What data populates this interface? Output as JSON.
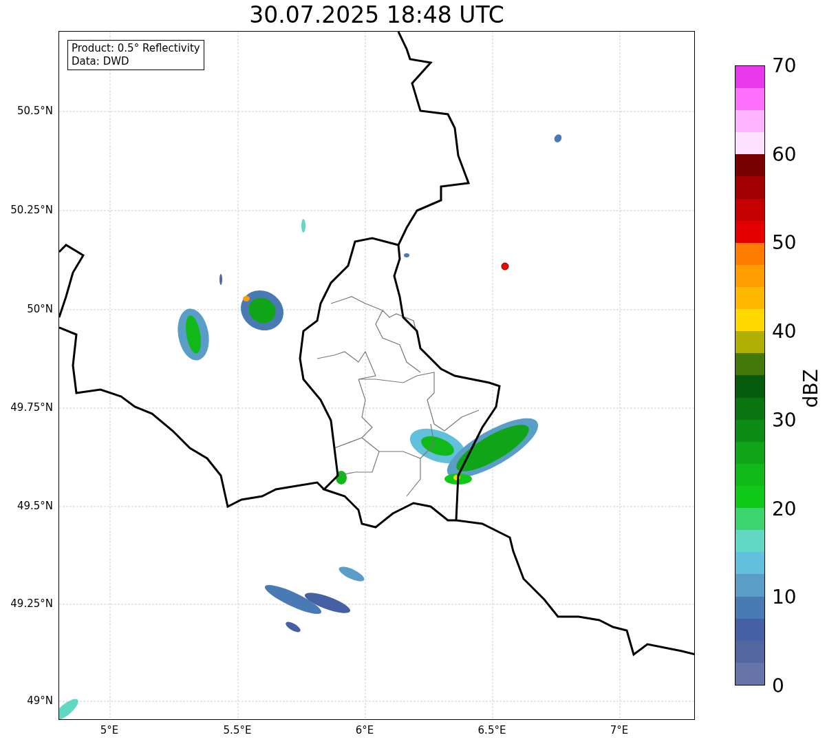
{
  "title": "30.07.2025 18:48 UTC",
  "info_box": [
    "Product: 0.5° Reflectivity",
    "Data: DWD"
  ],
  "map": {
    "y_labels": [
      "50.5°N",
      "50.25°N",
      "50°N",
      "49.75°N",
      "49.5°N",
      "49.25°N",
      "49°N"
    ],
    "x_labels": [
      "5°E",
      "5.5°E",
      "6°E",
      "6.5°E",
      "7°E"
    ]
  },
  "colorbar": {
    "label": "dBZ",
    "ticks": [
      "70",
      "60",
      "50",
      "40",
      "30",
      "20",
      "10",
      "0"
    ],
    "segments": [
      {
        "color": "#6674a8"
      },
      {
        "color": "#5466a0"
      },
      {
        "color": "#4660a4"
      },
      {
        "color": "#4a7ab4"
      },
      {
        "color": "#5a9ec8"
      },
      {
        "color": "#62c0dc"
      },
      {
        "color": "#62d8c4"
      },
      {
        "color": "#3cd46c"
      },
      {
        "color": "#10c818"
      },
      {
        "color": "#10b818"
      },
      {
        "color": "#10a418"
      },
      {
        "color": "#0c8c14"
      },
      {
        "color": "#0a7410"
      },
      {
        "color": "#065c0c"
      },
      {
        "color": "#447808"
      },
      {
        "color": "#b0b004"
      },
      {
        "color": "#ffd800"
      },
      {
        "color": "#ffb800"
      },
      {
        "color": "#ff9c00"
      },
      {
        "color": "#ff7c00"
      },
      {
        "color": "#e40000"
      },
      {
        "color": "#c40000"
      },
      {
        "color": "#a00000"
      },
      {
        "color": "#780000"
      },
      {
        "color": "#ffe0ff"
      },
      {
        "color": "#ffb4ff"
      },
      {
        "color": "#ff70ff"
      },
      {
        "color": "#e838ec"
      }
    ]
  }
}
